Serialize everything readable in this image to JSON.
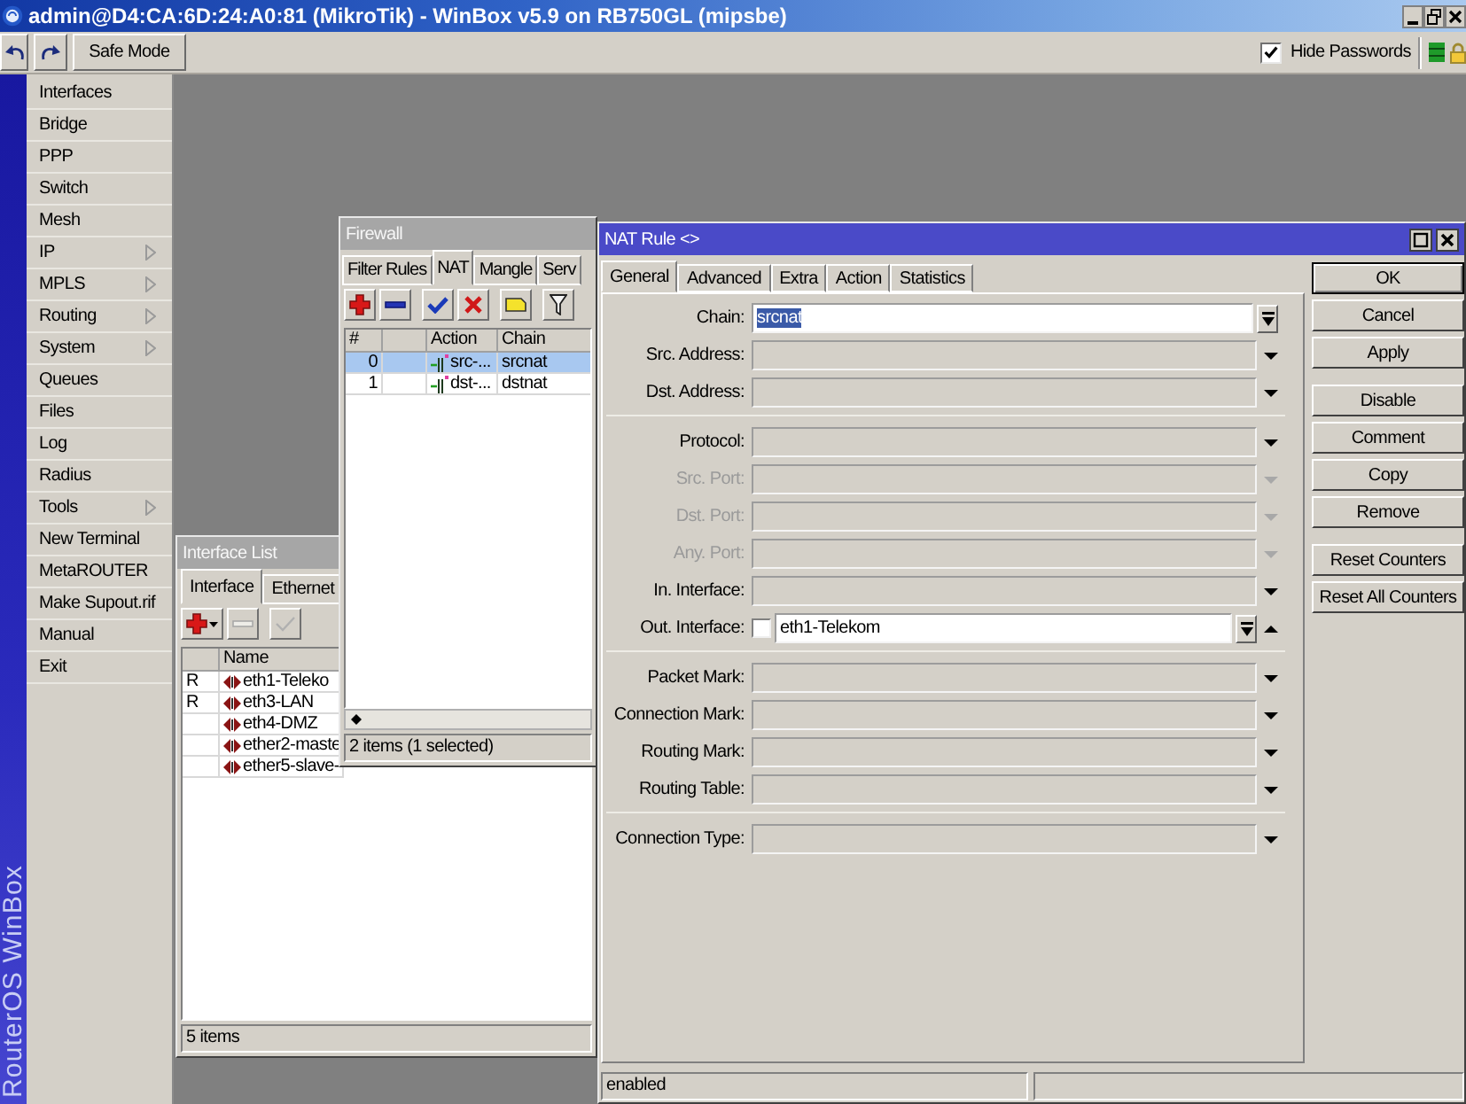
{
  "window": {
    "title": "admin@D4:CA:6D:24:A0:81 (MikroTik) - WinBox v5.9 on RB750GL (mipsbe)"
  },
  "toolbar": {
    "safe_mode": "Safe Mode",
    "hide_passwords": {
      "label": "Hide Passwords",
      "checked": true
    }
  },
  "brand": "RouterOS WinBox",
  "sidebar": {
    "items": [
      {
        "label": "Interfaces",
        "submenu": false
      },
      {
        "label": "Bridge",
        "submenu": false
      },
      {
        "label": "PPP",
        "submenu": false
      },
      {
        "label": "Switch",
        "submenu": false
      },
      {
        "label": "Mesh",
        "submenu": false
      },
      {
        "label": "IP",
        "submenu": true
      },
      {
        "label": "MPLS",
        "submenu": true
      },
      {
        "label": "Routing",
        "submenu": true
      },
      {
        "label": "System",
        "submenu": true
      },
      {
        "label": "Queues",
        "submenu": false
      },
      {
        "label": "Files",
        "submenu": false
      },
      {
        "label": "Log",
        "submenu": false
      },
      {
        "label": "Radius",
        "submenu": false
      },
      {
        "label": "Tools",
        "submenu": true
      },
      {
        "label": "New Terminal",
        "submenu": false
      },
      {
        "label": "MetaROUTER",
        "submenu": false
      },
      {
        "label": "Make Supout.rif",
        "submenu": false
      },
      {
        "label": "Manual",
        "submenu": false
      },
      {
        "label": "Exit",
        "submenu": false
      }
    ]
  },
  "interface_list": {
    "title": "Interface List",
    "tabs": [
      {
        "label": "Interface",
        "selected": true
      },
      {
        "label": "Ethernet",
        "selected": false
      }
    ],
    "toolbar": [
      {
        "kind": "add",
        "menu": true,
        "disabled": false
      },
      {
        "kind": "remove",
        "menu": false,
        "disabled": true
      },
      {
        "kind": "enable",
        "menu": false,
        "disabled": true
      }
    ],
    "columns": [
      "Name"
    ],
    "rows": [
      {
        "flag": "R",
        "name": "eth1-Teleko"
      },
      {
        "flag": "R",
        "name": "eth3-LAN"
      },
      {
        "name": "eth4-DMZ"
      },
      {
        "name": "ether2-maste"
      },
      {
        "name": "ether5-slave-"
      }
    ],
    "status": "5 items"
  },
  "firewall": {
    "title": "Firewall",
    "tabs": [
      {
        "label": "Filter Rules",
        "selected": false
      },
      {
        "label": "NAT",
        "selected": true
      },
      {
        "label": "Mangle",
        "selected": false
      },
      {
        "label": "Serv",
        "selected": false
      }
    ],
    "toolbar": [
      {
        "kind": "add",
        "menu": false,
        "disabled": false
      },
      {
        "kind": "remove",
        "menu": false,
        "disabled": false
      },
      {
        "kind": "enable",
        "menu": false,
        "disabled": false
      },
      {
        "kind": "disable",
        "menu": false,
        "disabled": false
      },
      {
        "kind": "comment",
        "menu": false,
        "disabled": false
      },
      {
        "kind": "filter",
        "menu": false,
        "disabled": false
      }
    ],
    "columns": [
      "#",
      "Action",
      "Chain"
    ],
    "rows": [
      {
        "number": "0",
        "action": "src-...",
        "chain": "srcnat",
        "selected": true
      },
      {
        "number": "1",
        "action": "dst-...",
        "chain": "dstnat",
        "selected": false
      }
    ],
    "status": "2 items (1 selected)"
  },
  "nat_rule": {
    "title": "NAT Rule <>",
    "tabs": [
      {
        "label": "General",
        "selected": true
      },
      {
        "label": "Advanced",
        "selected": false
      },
      {
        "label": "Extra",
        "selected": false
      },
      {
        "label": "Action",
        "selected": false
      },
      {
        "label": "Statistics",
        "selected": false
      }
    ],
    "field_groups": [
      {
        "fields": [
          {
            "label": "Chain:",
            "kind": "combo",
            "value": "srcnat",
            "highlighted": true,
            "removable": false,
            "disabled": false
          },
          {
            "label": "Src. Address:",
            "kind": "dropdown",
            "disabled": false
          },
          {
            "label": "Dst. Address:",
            "kind": "dropdown",
            "disabled": false
          }
        ]
      },
      {
        "fields": [
          {
            "label": "Protocol:",
            "kind": "dropdown",
            "disabled": false
          },
          {
            "label": "Src. Port:",
            "kind": "dropdown",
            "disabled": true
          },
          {
            "label": "Dst. Port:",
            "kind": "dropdown",
            "disabled": true
          },
          {
            "label": "Any. Port:",
            "kind": "dropdown",
            "disabled": true
          },
          {
            "label": "In. Interface:",
            "kind": "dropdown",
            "disabled": false
          },
          {
            "label": "Out. Interface:",
            "kind": "combo",
            "negate": {
              "checked": false
            },
            "value": "eth1-Telekom",
            "highlighted": false,
            "removable": true,
            "disabled": false
          }
        ]
      },
      {
        "fields": [
          {
            "label": "Packet Mark:",
            "kind": "dropdown",
            "disabled": false
          },
          {
            "label": "Connection Mark:",
            "kind": "dropdown",
            "disabled": false
          },
          {
            "label": "Routing Mark:",
            "kind": "dropdown",
            "disabled": false
          },
          {
            "label": "Routing Table:",
            "kind": "dropdown",
            "disabled": false
          }
        ]
      },
      {
        "fields": [
          {
            "label": "Connection Type:",
            "kind": "dropdown",
            "disabled": false
          }
        ]
      }
    ],
    "button_groups": [
      {
        "buttons": [
          {
            "label": "OK",
            "default": true
          },
          {
            "label": "Cancel",
            "default": false
          },
          {
            "label": "Apply",
            "default": false
          }
        ]
      },
      {
        "buttons": [
          {
            "label": "Disable",
            "default": false
          },
          {
            "label": "Comment",
            "default": false
          },
          {
            "label": "Copy",
            "default": false
          },
          {
            "label": "Remove",
            "default": false
          }
        ]
      },
      {
        "buttons": [
          {
            "label": "Reset Counters",
            "default": false
          },
          {
            "label": "Reset All Counters",
            "default": false
          }
        ]
      }
    ],
    "status": "enabled"
  }
}
